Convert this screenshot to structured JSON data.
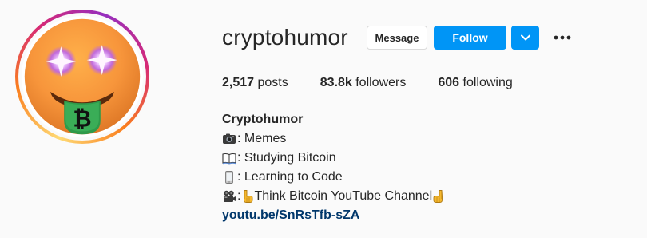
{
  "profile": {
    "username": "cryptohumor",
    "display_name": "Cryptohumor",
    "avatar_icon": "bitcoin-emoji-avatar",
    "buttons": {
      "message": "Message",
      "follow": "Follow",
      "dropdown_icon": "chevron-down-icon",
      "more_icon": "more-options-icon"
    },
    "stats": {
      "posts_count": "2,517",
      "posts_label": " posts",
      "followers_count": "83.8k",
      "followers_label": " followers",
      "following_count": "606",
      "following_label": " following"
    },
    "bio": {
      "line1_icon": "camera-icon",
      "line1_text": ": Memes",
      "line2_icon": "book-icon",
      "line2_text": ": Studying Bitcoin",
      "line3_icon": "phone-icon",
      "line3_text": ": Learning to Code",
      "line4_icon": "video-camera-icon",
      "line4_sep": ": ",
      "line4_text": "Think Bitcoin YouTube Channel",
      "link": "youtu.be/SnRsTfb-sZA"
    }
  },
  "colors": {
    "follow_blue": "#0095f6",
    "link_blue": "#00376b",
    "text": "#262626",
    "background": "#fafafa"
  }
}
